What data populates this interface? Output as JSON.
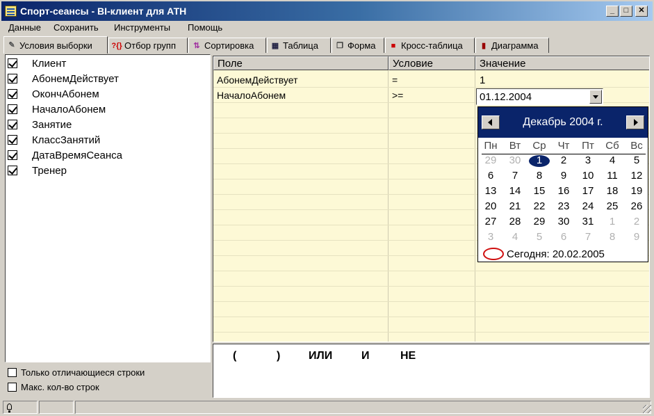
{
  "window": {
    "title": "Спорт-сеансы - BI-клиент для АТН",
    "minimize_label": "_",
    "maximize_label": "□",
    "close_label": "✕",
    "app_icon": "table-icon"
  },
  "menu": {
    "items": [
      "Данные",
      "Сохранить",
      "Инструменты",
      "Помощь"
    ]
  },
  "tabs": [
    {
      "label": "Условия выборки",
      "icon": "filter-conditions-icon",
      "active": true
    },
    {
      "label": "Отбор групп",
      "icon": "group-filter-icon",
      "active": false
    },
    {
      "label": "Сортировка",
      "icon": "sort-icon",
      "active": false
    },
    {
      "label": "Таблица",
      "icon": "table-icon",
      "active": false
    },
    {
      "label": "Форма",
      "icon": "form-icon",
      "active": false
    },
    {
      "label": "Кросс-таблица",
      "icon": "cross-table-icon",
      "active": false
    },
    {
      "label": "Диаграмма",
      "icon": "chart-icon",
      "active": false
    }
  ],
  "fields": [
    {
      "label": "Клиент",
      "checked": true
    },
    {
      "label": "АбонемДействует",
      "checked": true
    },
    {
      "label": "ОкончАбонем",
      "checked": true
    },
    {
      "label": "НачалоАбонем",
      "checked": true
    },
    {
      "label": "Занятие",
      "checked": true
    },
    {
      "label": "КлассЗанятий",
      "checked": true
    },
    {
      "label": "ДатаВремяСеанса",
      "checked": true
    },
    {
      "label": "Тренер",
      "checked": true
    }
  ],
  "options": {
    "distinct_rows": "Только отличающиеся строки",
    "max_rows": "Макс. кол-во строк"
  },
  "grid": {
    "headers": [
      "Поле",
      "Условие",
      "Значение"
    ],
    "rows": [
      {
        "field": "АбонемДействует",
        "condition": "=",
        "value": "1"
      },
      {
        "field": "НачалоАбонем",
        "condition": ">=",
        "value": "01.12.2004"
      }
    ],
    "background": "#fdf9d6"
  },
  "calendar": {
    "month_title": "Декабрь 2004 г.",
    "weekdays": [
      "Пн",
      "Вт",
      "Ср",
      "Чт",
      "Пт",
      "Сб",
      "Вс"
    ],
    "weeks": [
      [
        "29",
        "30",
        "1",
        "2",
        "3",
        "4",
        "5"
      ],
      [
        "6",
        "7",
        "8",
        "9",
        "10",
        "11",
        "12"
      ],
      [
        "13",
        "14",
        "15",
        "16",
        "17",
        "18",
        "19"
      ],
      [
        "20",
        "21",
        "22",
        "23",
        "24",
        "25",
        "26"
      ],
      [
        "27",
        "28",
        "29",
        "30",
        "31",
        "1",
        "2"
      ],
      [
        "3",
        "4",
        "5",
        "6",
        "7",
        "8",
        "9"
      ]
    ],
    "selected_day": "1",
    "today_text": "Сегодня: 20.02.2005",
    "header_color": "#0a246a"
  },
  "operators": [
    "(",
    ")",
    "ИЛИ",
    "И",
    "НЕ"
  ]
}
